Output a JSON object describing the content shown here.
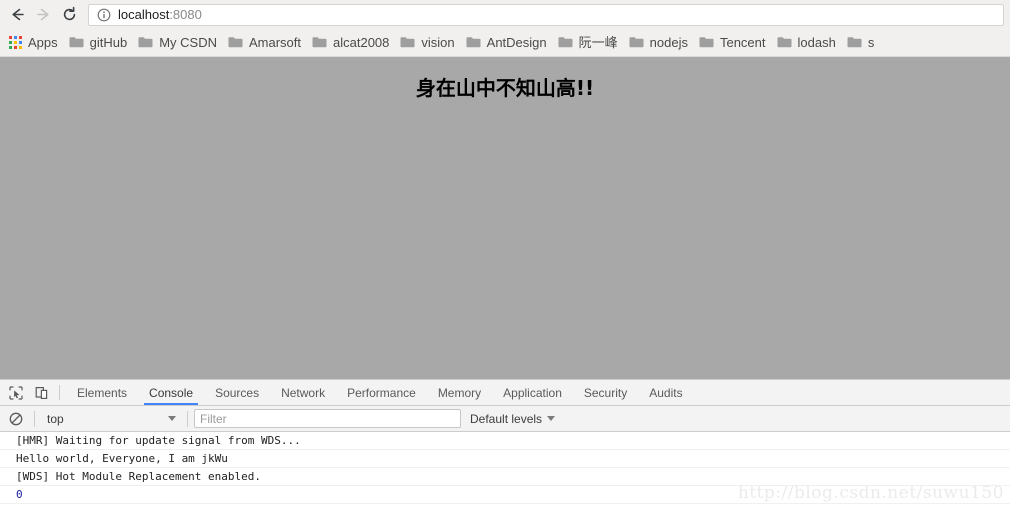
{
  "browser": {
    "nav": {
      "back_icon": "arrow-left-icon",
      "forward_icon": "arrow-right-icon",
      "reload_icon": "reload-icon"
    },
    "omnibox": {
      "info_icon": "info-circle-icon",
      "url_host": "localhost",
      "url_port": ":8080"
    },
    "bookmarks": {
      "apps_label": "Apps",
      "items": [
        {
          "label": "gitHub"
        },
        {
          "label": "My CSDN"
        },
        {
          "label": "Amarsoft"
        },
        {
          "label": "alcat2008"
        },
        {
          "label": "vision"
        },
        {
          "label": "AntDesign"
        },
        {
          "label": "阮一峰"
        },
        {
          "label": "nodejs"
        },
        {
          "label": "Tencent"
        },
        {
          "label": "lodash"
        },
        {
          "label": "s"
        }
      ]
    }
  },
  "page": {
    "heading": "身在山中不知山高!!",
    "background_color": "#a8a8a8"
  },
  "devtools": {
    "tools": {
      "inspect_icon": "inspect-element-icon",
      "device_icon": "device-toolbar-icon"
    },
    "tabs": [
      {
        "label": "Elements",
        "active": false
      },
      {
        "label": "Console",
        "active": true
      },
      {
        "label": "Sources",
        "active": false
      },
      {
        "label": "Network",
        "active": false
      },
      {
        "label": "Performance",
        "active": false
      },
      {
        "label": "Memory",
        "active": false
      },
      {
        "label": "Application",
        "active": false
      },
      {
        "label": "Security",
        "active": false
      },
      {
        "label": "Audits",
        "active": false
      }
    ],
    "active_tab_underline_color": "#4285f4",
    "filterbar": {
      "clear_icon": "clear-console-icon",
      "context_value": "top",
      "filter_value": "",
      "filter_placeholder": "Filter",
      "levels_label": "Default levels"
    },
    "console_logs": [
      {
        "text": "[HMR] Waiting for update signal from WDS...",
        "kind": "log"
      },
      {
        "text": "Hello world, Everyone, I am jkWu",
        "kind": "log"
      },
      {
        "text": "[WDS] Hot Module Replacement enabled.",
        "kind": "log"
      },
      {
        "text": "0",
        "kind": "result"
      }
    ],
    "result_color": "#1a1aa6"
  },
  "watermark": "http://blog.csdn.net/suwu150"
}
